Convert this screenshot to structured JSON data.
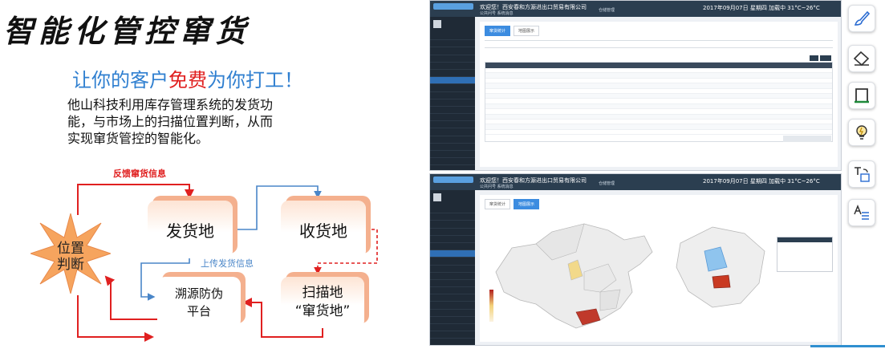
{
  "slide": {
    "title": "智能化管控窜货",
    "subtitle_pre": "让你的客户",
    "subtitle_free": "免费",
    "subtitle_post": "为你打工！",
    "description": "他山科技利用库存管理系统的发货功能，与市场上的扫描位置判断，从而实现窜货管控的智能化。",
    "feedback_label": "反馈窜货信息",
    "upload_label": "上传发货信息",
    "nodes": {
      "ship": "发货地",
      "receive": "收货地",
      "trace_line1": "溯源防伪",
      "trace_line2": "平台",
      "scan_line1": "扫描地",
      "scan_line2": "“窜货地”",
      "position_line1": "位置",
      "position_line2": "判断"
    }
  },
  "screenshot1": {
    "company": "欢迎您！西安春和方源进出口贸易有限公司",
    "links": "公共问号    系统消息",
    "center": "仓储管理",
    "date": "2017年09月07日  星期四  加载中  31°C~26°C",
    "tabs": [
      "窜货统计",
      "地图展示"
    ]
  },
  "screenshot2": {
    "company": "欢迎您！西安春和方源进出口贸易有限公司",
    "links": "公共问号    系统消息",
    "center": "仓储管理",
    "date": "2017年09月07日  星期四  加载中  31°C~26°C",
    "tabs": [
      "窜货统计",
      "地图展示"
    ]
  },
  "toolbar": {
    "icons": [
      "brush-icon",
      "eraser-icon",
      "frame-icon",
      "lightbulb-icon",
      "text-convert-icon",
      "text-format-icon"
    ]
  },
  "colors": {
    "accent_red": "#e02020",
    "accent_blue": "#2f7fd0",
    "box_shadow": "#f4b08e",
    "ui_dark": "#2b3e50"
  }
}
